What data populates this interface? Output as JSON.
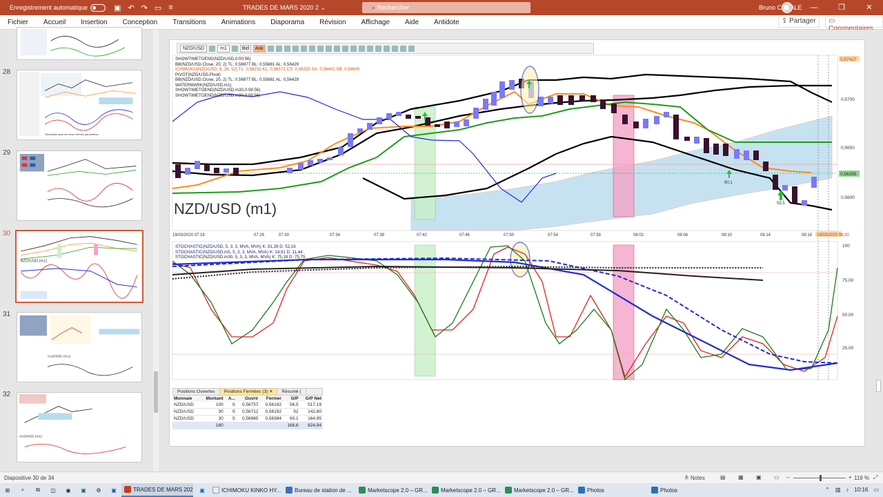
{
  "titlebar": {
    "autosave_label": "Enregistrement automatique",
    "doc_title": "TRADES DE MARS 2020 2",
    "search_placeholder": "Rechercher",
    "user_name": "Bruno CANALE"
  },
  "menu": [
    "Fichier",
    "Accueil",
    "Insertion",
    "Conception",
    "Transitions",
    "Animations",
    "Diaporama",
    "Révision",
    "Affichage",
    "Aide",
    "Antidote"
  ],
  "share_label": "Partager",
  "comments_label": "Commentaires",
  "thumbnails": [
    {
      "num": "28",
      "selected": false
    },
    {
      "num": "29",
      "selected": false
    },
    {
      "num": "30",
      "selected": true
    },
    {
      "num": "31",
      "selected": false
    },
    {
      "num": "32",
      "selected": false
    }
  ],
  "marketscope": {
    "symbol_select": "NZD/USD",
    "timeframe_select": "m1",
    "bid_label": "Bid",
    "ask_label": "Ask",
    "big_symbol": "NZD/USD (m1)",
    "legend_top": [
      "SHOWTIMETOEND(NZD/USD,0:00:56)",
      "BB(NZD/USD.Close, 20, 2)  TL: 0,56977  BL: 0,55881  AL: 0,56429",
      "ICHIMOKU(NZD/USD, 9, 26, 52)  TL: 0,56231  KL: 0,56571  CS: 0,56255  SA: 0,56401  SB: 0,56600",
      "PIVOT(NZD/USD,Pivot)",
      "BB(NZD/USD.Close, 20, 2)  TL: 0,56977  BL: 0,55881  AL: 0,56429",
      "WATERMARK(NZD/USD,m1)",
      "SHOWTIMETOEND(NZD/USD.m30,0:08:56)",
      "SHOWTIMETOEND(NZD/USD.m30,0:08:56)"
    ],
    "legend_stoch": [
      "STOCHASTIC(NZD/USD, 5, 3, 3, MVA, MVA)  K: 81,28  D: 52,16",
      "STOCHASTIC(NZD/USD.m5, 5, 3, 3, MVA, MVA)  K: 14,91  D: 11,44",
      "STOCHASTIC(NZD/USD.m30, 5, 3, 3, MVA, MVA)  K: 75,18  D: 75,75"
    ],
    "price_ticks": [
      "0,5700",
      "0,5650",
      "0,5600"
    ],
    "price_tags": {
      "top": "0,57427",
      "current": "0,56255"
    },
    "time_ticks": [
      "19/03/2020 07:18",
      "07:26",
      "07:30",
      "07:34",
      "07:38",
      "07:42",
      "07:46",
      "07:50",
      "07:54",
      "07:58",
      "08:02",
      "08:06",
      "08:10",
      "08:14",
      "08:18"
    ],
    "time_tag": "19/03/2020 08:20",
    "stoch_ticks": [
      "100",
      "75,00",
      "50,00",
      "25,00"
    ],
    "annotations": [
      "60,1",
      "55,5"
    ]
  },
  "positions": {
    "tabs": [
      "Positions Ouvertes",
      "Positions Fermées (3)",
      "Résumé ("
    ],
    "columns": [
      "Monnaie",
      "Montant",
      "A...",
      "Ouvrir",
      "Fermer",
      "G/P",
      "G/P Net"
    ],
    "rows": [
      [
        "NZD/USD",
        "100",
        "S",
        "0,56757",
        "0,56192",
        "56,5",
        "517,19"
      ],
      [
        "NZD/USD",
        "30",
        "S",
        "0,56712",
        "0,56192",
        "52",
        "142,80"
      ],
      [
        "NZD/USD",
        "30",
        "S",
        "0,56985",
        "0,56384",
        "60,1",
        "164,95"
      ]
    ],
    "total": [
      "",
      "160",
      "",
      "",
      "",
      "168,6",
      "824,94"
    ]
  },
  "statusbar": {
    "slide_info": "Diapositive 30 de 34",
    "notes_label": "Notes",
    "zoom": "119 %"
  },
  "taskbar": {
    "apps": [
      {
        "label": "TRADES DE MARS 202...",
        "color": "#c43e1c",
        "active": true
      },
      {
        "label": "ICHIMOKU KINKO HY...",
        "color": "#e8eef5",
        "active": false
      },
      {
        "label": "Bureau de station de ...",
        "color": "#3b6fb6",
        "active": false
      },
      {
        "label": "Marketscope 2.0 – GR...",
        "color": "#2e8b57",
        "active": false
      },
      {
        "label": "Marketscope 2.0 – GR...",
        "color": "#2e8b57",
        "active": false
      },
      {
        "label": "Marketscope 2.0 – GR...",
        "color": "#2e8b57",
        "active": false
      },
      {
        "label": "Photos",
        "color": "#2a6fbf",
        "active": false
      },
      {
        "label": "Photos",
        "color": "#2a6fbf",
        "active": false
      }
    ],
    "time": "10:16"
  },
  "colors": {
    "accent": "#b7472a",
    "bollinger": "#000000",
    "tenkan": "#ff8c1a",
    "kijun": "#1a9c1a",
    "chikou": "#1f2bd6",
    "cloud": "#b9dbee",
    "bull_candle": "#7a7af5",
    "bear_candle": "#3a1030",
    "green_zone": "#c8f0c8",
    "red_zone": "#f5a3c7"
  }
}
